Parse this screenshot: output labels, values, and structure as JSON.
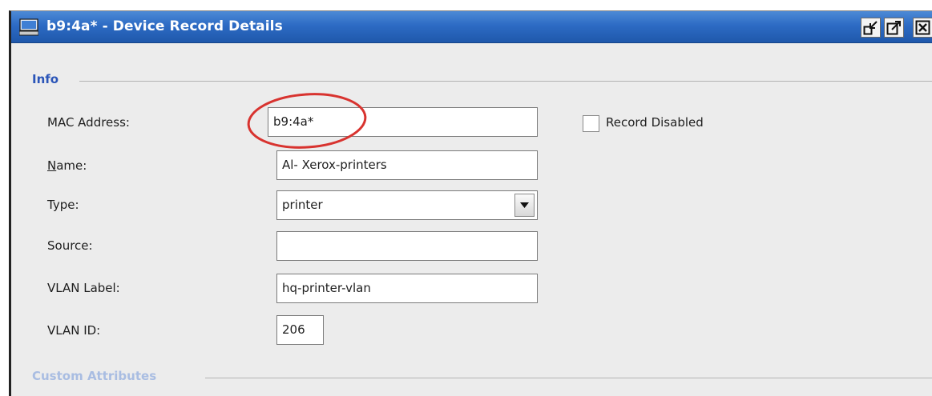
{
  "window": {
    "title": "b9:4a* - Device Record Details"
  },
  "info_group": {
    "title": "Info",
    "fields": {
      "mac_address": {
        "label": "MAC Address:",
        "value": "b9:4a*"
      },
      "name": {
        "label_mnemonic": "N",
        "label_rest": "ame:",
        "value": "Al- Xerox-printers"
      },
      "type": {
        "label": "Type:",
        "value": "printer"
      },
      "source": {
        "label": "Source:",
        "value": ""
      },
      "vlan_label": {
        "label": "VLAN Label:",
        "value": "hq-printer-vlan"
      },
      "vlan_id": {
        "label": "VLAN ID:",
        "value": "206"
      }
    },
    "record_disabled": {
      "label": "Record Disabled",
      "checked": false
    }
  },
  "custom_attributes_group": {
    "title": "Custom Attributes"
  },
  "icons": {
    "window_icon": "monitor-icon",
    "minimize": "restore-down-icon",
    "maximize": "pop-out-icon",
    "close": "close-icon",
    "dropdown": "chevron-down-icon"
  },
  "colors": {
    "titlebar": "#2d6bc4",
    "group_title": "#2b55b8",
    "highlight": "#d8332f"
  }
}
